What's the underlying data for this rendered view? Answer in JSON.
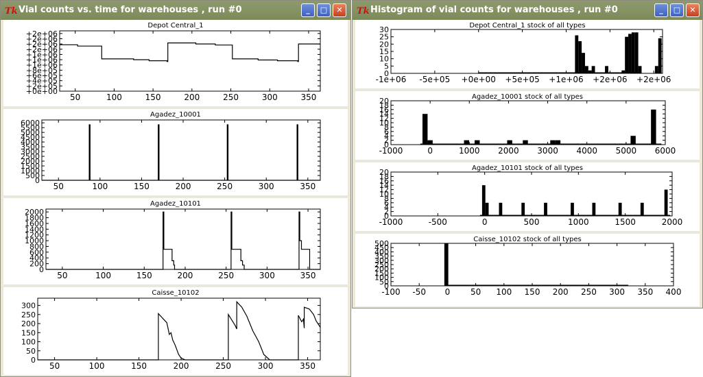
{
  "windows": [
    {
      "id": "w1",
      "title": "Vial counts vs. time for warehouses , run #0"
    },
    {
      "id": "w2",
      "title": "Histogram of vial counts for warehouses , run #0"
    }
  ],
  "window_buttons": {
    "minimize": "_",
    "maximize": "□",
    "close": "✕"
  },
  "colors": {
    "titlebar": "#7c8a5a",
    "line": "#000000",
    "bar": "#000000",
    "separator": "#e8e8dc"
  },
  "chart_data": [
    {
      "type": "line",
      "title": "Depot Central_1",
      "xlim": [
        30,
        365
      ],
      "ylim": [
        0,
        2300000
      ],
      "xticks": [
        50,
        100,
        150,
        200,
        250,
        300,
        350
      ],
      "yticks": [
        0,
        200000,
        400000,
        600000,
        800000,
        1000000,
        1200000,
        1400000,
        1600000,
        1800000,
        2000000,
        2200000
      ],
      "yticklabels": [
        "+0e+00",
        "+2e+05",
        "+4e+05",
        "+6e+05",
        "+8e+05",
        "+1e+06",
        "+1e+06",
        "+1e+06",
        "+2e+06",
        "+2e+06",
        "+2e+06",
        "+2e+06"
      ],
      "x": [
        30,
        53,
        53,
        84,
        84,
        125,
        125,
        145,
        145,
        168,
        168,
        169,
        169,
        205,
        205,
        230,
        230,
        252,
        252,
        285,
        285,
        310,
        310,
        336,
        336,
        337,
        337,
        365
      ],
      "y": [
        1770000,
        1770000,
        1720000,
        1720000,
        1230000,
        1230000,
        1200000,
        1200000,
        1160000,
        1160000,
        1130000,
        1130000,
        1840000,
        1840000,
        1800000,
        1800000,
        1760000,
        1760000,
        1230000,
        1230000,
        1190000,
        1190000,
        1160000,
        1160000,
        1130000,
        1130000,
        1800000,
        1800000
      ]
    },
    {
      "type": "line",
      "title": "Agadez_10001",
      "xlim": [
        30,
        365
      ],
      "ylim": [
        0,
        6300
      ],
      "xticks": [
        50,
        100,
        150,
        200,
        250,
        300,
        350
      ],
      "yticks": [
        0,
        500,
        1000,
        1500,
        2000,
        2500,
        3000,
        3500,
        4000,
        4500,
        5000,
        5500,
        6000
      ],
      "yticklabels": [
        "0",
        "500",
        "1000",
        "1500",
        "2000",
        "2500",
        "3000",
        "3500",
        "4000",
        "4500",
        "5000",
        "5500",
        "6000"
      ],
      "x": [
        30,
        87,
        87,
        88,
        88,
        170,
        170,
        171,
        171,
        253,
        253,
        254,
        254,
        337,
        337,
        338,
        338,
        365
      ],
      "y": [
        0,
        0,
        5800,
        5800,
        0,
        0,
        5800,
        5800,
        0,
        0,
        5800,
        5800,
        0,
        0,
        5800,
        5800,
        0,
        0
      ]
    },
    {
      "type": "line",
      "title": "Agadez_10101",
      "xlim": [
        30,
        365
      ],
      "ylim": [
        0,
        2100
      ],
      "xticks": [
        50,
        100,
        150,
        200,
        250,
        300,
        350
      ],
      "yticks": [
        0,
        200,
        400,
        600,
        800,
        1000,
        1200,
        1400,
        1600,
        1800,
        2000
      ],
      "yticklabels": [
        "0",
        "200",
        "400",
        "600",
        "800",
        "1000",
        "1200",
        "1400",
        "1600",
        "1800",
        "2000"
      ],
      "x": [
        30,
        173,
        173,
        174,
        174,
        184,
        184,
        186,
        186,
        187,
        187,
        190,
        190,
        256,
        256,
        257,
        257,
        268,
        268,
        270,
        270,
        272,
        272,
        275,
        275,
        339,
        339,
        340,
        340,
        342,
        342,
        352,
        352,
        354,
        354,
        365
      ],
      "y": [
        0,
        0,
        2000,
        2000,
        700,
        700,
        300,
        300,
        150,
        150,
        0,
        0,
        0,
        0,
        2000,
        2000,
        700,
        700,
        300,
        300,
        150,
        150,
        0,
        0,
        0,
        0,
        2000,
        2000,
        1000,
        1000,
        700,
        700,
        0,
        0,
        0,
        0
      ]
    },
    {
      "type": "line",
      "title": "Caisse_10102",
      "xlim": [
        30,
        365
      ],
      "ylim": [
        0,
        340
      ],
      "xticks": [
        50,
        100,
        150,
        200,
        250,
        300,
        350
      ],
      "yticks": [
        0,
        50,
        100,
        150,
        200,
        250,
        300
      ],
      "yticklabels": [
        "0",
        "50",
        "100",
        "150",
        "200",
        "250",
        "300"
      ],
      "x": [
        30,
        173,
        173,
        180,
        183,
        186,
        188,
        190,
        193,
        197,
        200,
        205,
        256,
        256,
        260,
        264,
        266,
        266,
        272,
        278,
        285,
        292,
        298,
        305,
        339,
        339,
        343,
        345,
        346,
        346,
        352,
        357,
        360,
        365
      ],
      "y": [
        0,
        0,
        255,
        220,
        205,
        140,
        150,
        110,
        80,
        30,
        10,
        0,
        0,
        250,
        220,
        190,
        170,
        320,
        290,
        240,
        160,
        100,
        30,
        0,
        0,
        245,
        210,
        225,
        175,
        290,
        280,
        250,
        215,
        180
      ]
    },
    {
      "type": "bar",
      "title": "Depot Central_1 stock of all types",
      "xlim": [
        -1000000,
        2100000
      ],
      "ylim": [
        0,
        30
      ],
      "xticks": [
        -1000000,
        -500000,
        0,
        500000,
        1000000,
        1500000,
        2000000
      ],
      "xticklabels": [
        "-1e+06",
        "-5e+05",
        "+0e+00",
        "+5e+05",
        "+1e+06",
        "+2e+06",
        "+2e+06"
      ],
      "yticks": [
        0,
        5,
        10,
        15,
        20,
        25,
        30
      ],
      "yticklabels": [
        "0",
        "5",
        "10",
        "15",
        "20",
        "25",
        "30"
      ],
      "baseline": [
        0,
        1850000
      ],
      "binwidth": 38000,
      "x": [
        1120000,
        1158000,
        1196000,
        1234000,
        1272000,
        1310000,
        1462000,
        1652000,
        1690000,
        1728000,
        1766000,
        1804000,
        1842000,
        2032000,
        2070000
      ],
      "values": [
        26,
        22,
        14,
        5,
        2,
        5,
        5,
        2,
        25,
        27,
        28,
        28,
        5,
        5,
        24
      ]
    },
    {
      "type": "bar",
      "title": "Agadez_10001 stock of all types",
      "xlim": [
        -1000,
        6000
      ],
      "ylim": [
        0,
        20
      ],
      "xticks": [
        -1000,
        0,
        1000,
        2000,
        3000,
        4000,
        5000,
        6000
      ],
      "yticks": [
        0,
        2,
        4,
        6,
        8,
        10,
        12,
        14,
        16,
        18,
        20
      ],
      "yticklabels": [
        "0",
        "2",
        "4",
        "6",
        "8",
        "10",
        "12",
        "14",
        "16",
        "18",
        "20"
      ],
      "baseline": [
        -250,
        5900
      ],
      "binwidth": 130,
      "x": [
        -130,
        0,
        930,
        1200,
        2030,
        2430,
        3130,
        3260,
        5180,
        5700
      ],
      "values": [
        14,
        2,
        2,
        2,
        2,
        2,
        2,
        2,
        4,
        16
      ]
    },
    {
      "type": "bar",
      "title": "Agadez_10101 stock of all types",
      "xlim": [
        -1000,
        2000
      ],
      "ylim": [
        0,
        20
      ],
      "xticks": [
        -1000,
        -500,
        0,
        500,
        1000,
        1500,
        2000
      ],
      "yticks": [
        0,
        2,
        4,
        6,
        8,
        10,
        12,
        14,
        16,
        18,
        20
      ],
      "yticklabels": [
        "0",
        "2",
        "4",
        "6",
        "8",
        "10",
        "12",
        "14",
        "16",
        "18",
        "20"
      ],
      "baseline": [
        -50,
        1980
      ],
      "binwidth": 35,
      "x": [
        -10,
        25,
        170,
        410,
        650,
        935,
        1165,
        1445,
        1680,
        1935
      ],
      "values": [
        14,
        6,
        6,
        6,
        6,
        6,
        6,
        6,
        6,
        12
      ]
    },
    {
      "type": "bar",
      "title": "Caisse_10102 stock of all types",
      "xlim": [
        -100,
        400
      ],
      "ylim": [
        0,
        500
      ],
      "xticks": [
        -100,
        -50,
        0,
        50,
        100,
        150,
        200,
        250,
        300,
        350,
        400
      ],
      "yticks": [
        0,
        50,
        100,
        150,
        200,
        250,
        300,
        350,
        400,
        450,
        500
      ],
      "yticklabels": [
        "0",
        "50",
        "100",
        "150",
        "200",
        "250",
        "300",
        "350",
        "400",
        "450",
        "500"
      ],
      "baseline": [
        -5,
        320
      ],
      "binwidth": 7,
      "x": [
        -2,
        70,
        80,
        100,
        150,
        160,
        200,
        230,
        280,
        315
      ],
      "values": [
        500,
        8,
        8,
        8,
        8,
        8,
        8,
        8,
        8,
        8
      ]
    }
  ]
}
